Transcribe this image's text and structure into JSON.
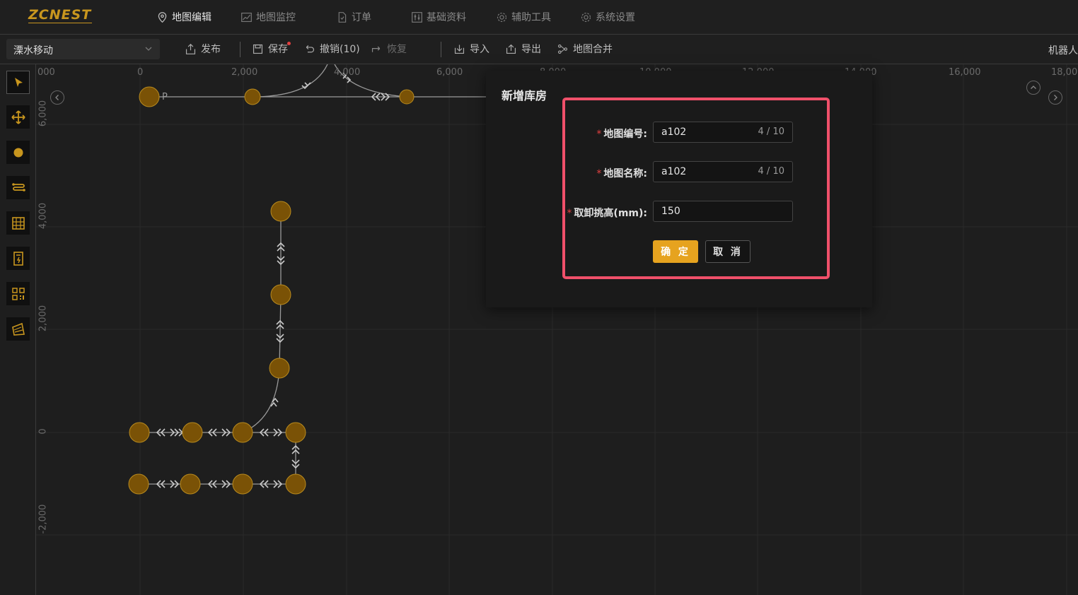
{
  "app": {
    "logo_text": "ZCNEST",
    "accent_color": "#c8961e"
  },
  "topnav": {
    "items": [
      {
        "label": "地图编辑",
        "icon": "map-pin-icon",
        "active": true
      },
      {
        "label": "地图监控",
        "icon": "line-chart-icon",
        "active": false
      },
      {
        "label": "订单",
        "icon": "document-icon",
        "active": false
      },
      {
        "label": "基础资料",
        "icon": "sliders-icon",
        "active": false
      },
      {
        "label": "辅助工具",
        "icon": "gear-icon",
        "active": false
      },
      {
        "label": "系统设置",
        "icon": "gear-icon",
        "active": false
      }
    ]
  },
  "toolbar": {
    "map_select_value": "溧水移动",
    "publish": "发布",
    "save": "保存",
    "undo": "撤销(10)",
    "redo": "恢复",
    "import": "导入",
    "export": "导出",
    "merge": "地图合并",
    "robot": "机器人"
  },
  "sidebar": {
    "tools": [
      "select-arrow-icon",
      "move-icon",
      "point-icon",
      "path-icon",
      "shelf-icon",
      "elevator-icon",
      "qr-code-icon",
      "area-icon"
    ]
  },
  "canvas": {
    "x_ticks": [
      "000",
      "0",
      "2,000",
      "4,000",
      "6,000",
      "8,000",
      "10,000",
      "12,000",
      "14,000",
      "16,000",
      "18,00"
    ],
    "y_ticks": [
      "6,000",
      "4,000",
      "2,000",
      "0",
      "-2,000"
    ],
    "station_label": "P"
  },
  "modal": {
    "title": "新增库房",
    "fields": [
      {
        "label": "地图编号:",
        "value": "a102",
        "count": "4 / 10",
        "required_mark": "*"
      },
      {
        "label": "地图名称:",
        "value": "a102",
        "count": "4 / 10",
        "required_mark": "*"
      },
      {
        "label": "取卸挑高(mm):",
        "value": "150",
        "count": "",
        "required_mark": "*"
      }
    ],
    "ok": "确 定",
    "cancel": "取 消",
    "highlight_color": "#f0506a"
  }
}
